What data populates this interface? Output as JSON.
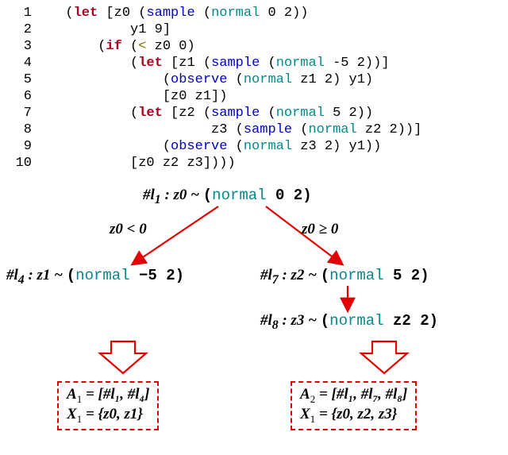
{
  "code": {
    "lines": [
      {
        "n": "1",
        "indent": 1,
        "tokens": [
          [
            "par",
            "("
          ],
          [
            "kw",
            "let "
          ],
          [
            "par",
            "["
          ],
          [
            "id",
            "z0 "
          ],
          [
            "par",
            "("
          ],
          [
            "act",
            "sample "
          ],
          [
            "par",
            "("
          ],
          [
            "fn",
            "normal "
          ],
          [
            "num",
            "0 2"
          ],
          [
            "par",
            "))"
          ]
        ]
      },
      {
        "n": "2",
        "indent": 5,
        "tokens": [
          [
            "id",
            "y1 9"
          ],
          [
            "par",
            "]"
          ]
        ]
      },
      {
        "n": "3",
        "indent": 3,
        "tokens": [
          [
            "par",
            "("
          ],
          [
            "kw",
            "if "
          ],
          [
            "par",
            "("
          ],
          [
            "op",
            "< "
          ],
          [
            "id",
            "z0 0"
          ],
          [
            "par",
            ")"
          ]
        ]
      },
      {
        "n": "4",
        "indent": 5,
        "tokens": [
          [
            "par",
            "("
          ],
          [
            "kw",
            "let "
          ],
          [
            "par",
            "["
          ],
          [
            "id",
            "z1 "
          ],
          [
            "par",
            "("
          ],
          [
            "act",
            "sample "
          ],
          [
            "par",
            "("
          ],
          [
            "fn",
            "normal "
          ],
          [
            "num",
            "-5 2"
          ],
          [
            "par",
            "))]"
          ]
        ]
      },
      {
        "n": "5",
        "indent": 7,
        "tokens": [
          [
            "par",
            "("
          ],
          [
            "act",
            "observe "
          ],
          [
            "par",
            "("
          ],
          [
            "fn",
            "normal "
          ],
          [
            "id",
            "z1 2"
          ],
          [
            "par",
            ") "
          ],
          [
            "id",
            "y1"
          ],
          [
            "par",
            ")"
          ]
        ]
      },
      {
        "n": "6",
        "indent": 7,
        "tokens": [
          [
            "par",
            "["
          ],
          [
            "id",
            "z0 z1"
          ],
          [
            "par",
            "])"
          ]
        ]
      },
      {
        "n": "7",
        "indent": 5,
        "tokens": [
          [
            "par",
            "("
          ],
          [
            "kw",
            "let "
          ],
          [
            "par",
            "["
          ],
          [
            "id",
            "z2 "
          ],
          [
            "par",
            "("
          ],
          [
            "act",
            "sample "
          ],
          [
            "par",
            "("
          ],
          [
            "fn",
            "normal "
          ],
          [
            "num",
            "5 2"
          ],
          [
            "par",
            "))"
          ]
        ]
      },
      {
        "n": "8",
        "indent": 10,
        "tokens": [
          [
            "id",
            "z3 "
          ],
          [
            "par",
            "("
          ],
          [
            "act",
            "sample "
          ],
          [
            "par",
            "("
          ],
          [
            "fn",
            "normal "
          ],
          [
            "id",
            "z2 2"
          ],
          [
            "par",
            "))]"
          ]
        ]
      },
      {
        "n": "9",
        "indent": 7,
        "tokens": [
          [
            "par",
            "("
          ],
          [
            "act",
            "observe "
          ],
          [
            "par",
            "("
          ],
          [
            "fn",
            "normal "
          ],
          [
            "id",
            "z3 2"
          ],
          [
            "par",
            ") "
          ],
          [
            "id",
            "y1"
          ],
          [
            "par",
            "))"
          ]
        ]
      },
      {
        "n": "10",
        "indent": 5,
        "tokens": [
          [
            "par",
            "["
          ],
          [
            "id",
            "z0 z2 z3"
          ],
          [
            "par",
            "])))"
          ]
        ]
      }
    ]
  },
  "tree": {
    "root": {
      "addr": "#l",
      "sub": "1",
      "var": "z0",
      "dist": "normal",
      "params": "0 2"
    },
    "cond_left": "z0 < 0",
    "cond_right": "z0 ≥ 0",
    "left": {
      "addr": "#l",
      "sub": "4",
      "var": "z1",
      "dist": "normal",
      "params": "−5 2"
    },
    "right_upper": {
      "addr": "#l",
      "sub": "7",
      "var": "z2",
      "dist": "normal",
      "params": "5 2"
    },
    "right_lower": {
      "addr": "#l",
      "sub": "8",
      "var": "z3",
      "dist": "normal",
      "params": "z2 2"
    }
  },
  "sets": {
    "A1": {
      "labelA": "A",
      "subA": "1",
      "valA": "= [#l₁, #l₄]",
      "labelX": "X",
      "subX": "1",
      "valX": "= {z0, z1}"
    },
    "A2": {
      "labelA": "A",
      "subA": "2",
      "valA": "= [#l₁, #l₇, #l₈]",
      "labelX": "X",
      "subX": "1",
      "valX": "= {z0, z2, z3}"
    }
  }
}
